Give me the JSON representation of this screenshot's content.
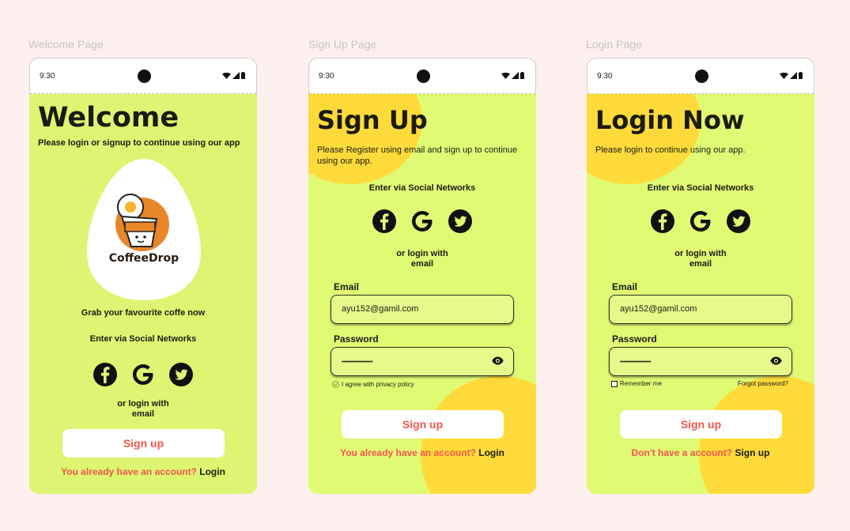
{
  "labels": {
    "welcome": "Welcome Page",
    "signup": "Sign Up Page",
    "login": "Login Page"
  },
  "status": {
    "time": "9:30"
  },
  "welcome": {
    "title": "Welcome",
    "subtitle": "Please login or signup to continue using our app",
    "logo_text": "CoffeeDrop",
    "tagline": "Grab your favourite coffe now",
    "social_title": "Enter via Social Networks",
    "or_line1": "or login with",
    "or_line2": "email",
    "button": "Sign up",
    "footer_question": "You already have an account?",
    "footer_link": "Login"
  },
  "signup": {
    "title": "Sign Up",
    "subtitle_line1": "Please Register using email and sign up to continue",
    "subtitle_line2": "using our app.",
    "social_title": "Enter via Social Networks",
    "or_line1": "or login with",
    "or_line2": "email",
    "email_label": "Email",
    "email_value": "ayu152@gamil.com",
    "password_label": "Password",
    "password_value": "••••••••••••••••••••",
    "agree": "I agree with privacy policy",
    "button": "Sign up",
    "footer_question": "You already have an account?",
    "footer_link": "Login"
  },
  "login": {
    "title": "Login Now",
    "subtitle": "Please login to continue using our app.",
    "social_title": "Enter via Social Networks",
    "or_line1": "or login with",
    "or_line2": "email",
    "email_label": "Email",
    "email_value": "ayu152@gamil.com",
    "password_label": "Password",
    "password_value": "••••••••••••••••••••",
    "remember": "Remember me",
    "forgot": "Forgot password?",
    "button": "Sign up",
    "footer_question": "Don't have a account?",
    "footer_link": "Sign up"
  },
  "icons": [
    "facebook-icon",
    "google-icon",
    "twitter-icon",
    "eye-icon",
    "wifi-icon",
    "signal-icon",
    "battery-icon"
  ],
  "colors": {
    "screen": "#ddf572",
    "accent_yellow": "#fedb3a",
    "button_text": "#f2574b",
    "background": "#fdf0ee"
  }
}
